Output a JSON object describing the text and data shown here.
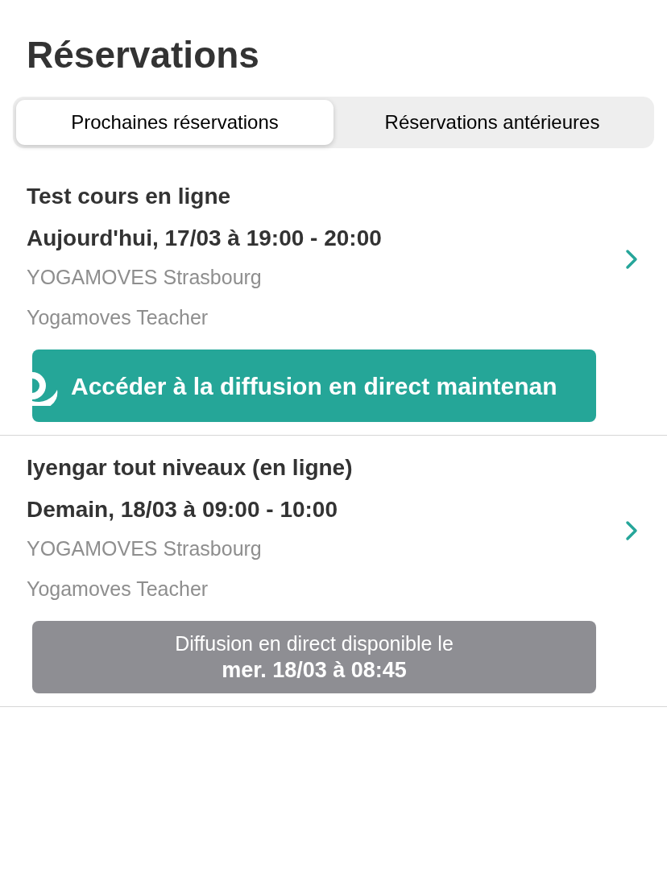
{
  "title": "Réservations",
  "tabs": [
    {
      "label": "Prochaines réservations",
      "selected": true
    },
    {
      "label": "Réservations antérieures",
      "selected": false
    }
  ],
  "bookings": [
    {
      "name": "Test cours en ligne",
      "when": "Aujourd'hui, 17/03 à 19:00 - 20:00",
      "studio": "YOGAMOVES Strasbourg",
      "teacher": "Yogamoves Teacher",
      "action": {
        "kind": "live",
        "label": "Accéder à la diffusion en direct maintenan"
      }
    },
    {
      "name": "Iyengar tout niveaux (en ligne)",
      "when": "Demain, 18/03 à 09:00 - 10:00",
      "studio": "YOGAMOVES Strasbourg",
      "teacher": "Yogamoves Teacher",
      "action": {
        "kind": "scheduled",
        "line_1": "Diffusion en direct disponible le",
        "line_2": "mer. 18/03 à 08:45"
      }
    }
  ]
}
